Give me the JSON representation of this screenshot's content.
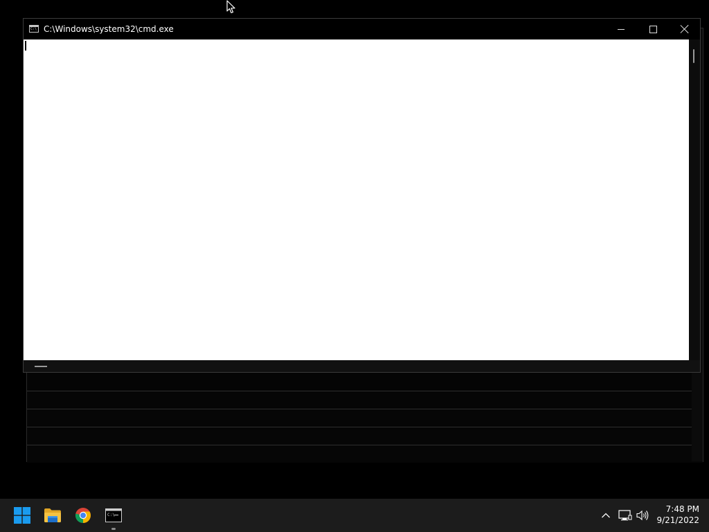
{
  "window": {
    "title": "C:\\Windows\\system32\\cmd.exe",
    "icon": "cmd-icon",
    "controls": {
      "minimize": "minimize-icon",
      "maximize": "maximize-icon",
      "close": "close-icon"
    }
  },
  "taskbar": {
    "apps": [
      {
        "name": "Start",
        "icon": "windows-logo-icon"
      },
      {
        "name": "File Explorer",
        "icon": "folder-icon"
      },
      {
        "name": "Google Chrome",
        "icon": "chrome-icon"
      },
      {
        "name": "Command Prompt",
        "icon": "cmd-icon",
        "running": true
      }
    ],
    "tray": {
      "chevron": "chevron-up-icon",
      "network": "network-icon",
      "volume": "volume-icon"
    },
    "clock": {
      "time": "7:48 PM",
      "date": "9/21/2022"
    }
  },
  "colors": {
    "taskbar_bg": "#1c1c1c",
    "windows_blue": "#1a9bef",
    "folder_yellow": "#f5c242"
  }
}
